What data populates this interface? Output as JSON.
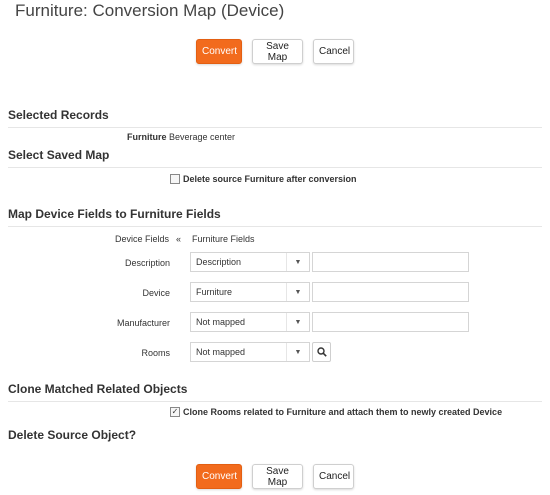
{
  "title": "Furniture: Conversion Map (Device)",
  "buttons": {
    "convert": "Convert",
    "save_map": "Save Map",
    "cancel": "Cancel"
  },
  "sections": {
    "selected_records": "Selected Records",
    "select_saved_map": "Select Saved Map",
    "map_fields": "Map Device Fields to Furniture Fields",
    "clone_related": "Clone Matched Related Objects",
    "delete_source": "Delete Source Object?"
  },
  "selected_record": {
    "module": "Furniture",
    "name": "Beverage center"
  },
  "delete_source_option": {
    "label": "Delete source Furniture after conversion",
    "checked": false
  },
  "mapping": {
    "left_header": "Device Fields",
    "arrow": "«",
    "right_header": "Furniture Fields",
    "rows": [
      {
        "label": "Description",
        "selected": "Description",
        "has_text": true,
        "text_value": ""
      },
      {
        "label": "Device",
        "selected": "Furniture",
        "has_text": true,
        "text_value": ""
      },
      {
        "label": "Manufacturer",
        "selected": "Not mapped",
        "has_text": true,
        "text_value": ""
      },
      {
        "label": "Rooms",
        "selected": "Not mapped",
        "has_text": false,
        "has_search": true
      }
    ]
  },
  "clone_option": {
    "label": "Clone Rooms related to Furniture and attach them to newly created Device",
    "checked": true
  },
  "colors": {
    "primary": "#f26b1d",
    "border": "#d5d5d5",
    "divider": "#e6e6e6"
  },
  "icons": {
    "dropdown": "chevron-down-icon",
    "search": "search-icon",
    "checkbox_checked": "check-icon"
  }
}
